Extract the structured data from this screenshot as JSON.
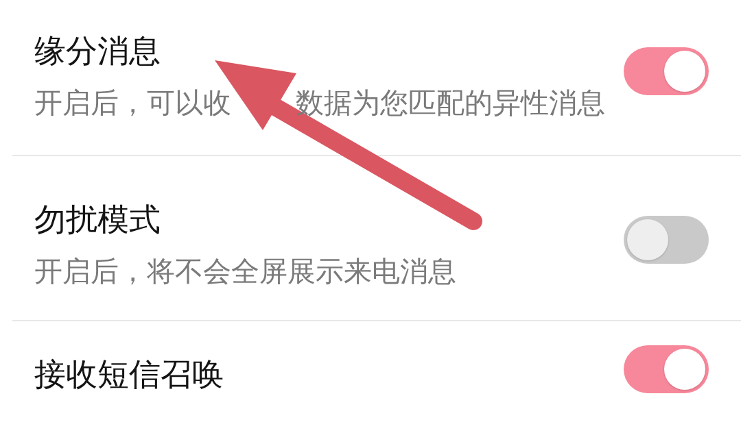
{
  "settings": [
    {
      "title": "缘分消息",
      "description": [
        "开启后，可以收",
        "数据为您匹配的异性消息"
      ],
      "on": true
    },
    {
      "title": "勿扰模式",
      "description": [
        "开启后，将不会全屏展示来电消息"
      ],
      "on": false
    },
    {
      "title": "接收短信召唤",
      "on": true
    }
  ]
}
